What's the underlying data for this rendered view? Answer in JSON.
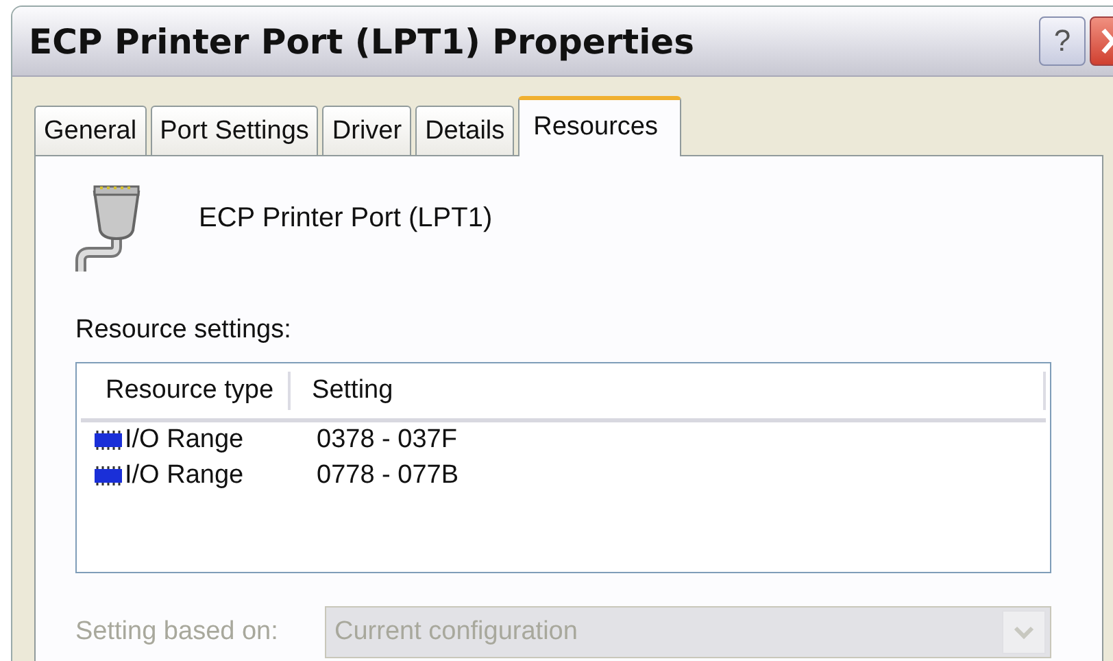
{
  "window": {
    "title": "ECP Printer Port (LPT1) Properties",
    "help": "?"
  },
  "tabs": [
    {
      "label": "General",
      "selected": false
    },
    {
      "label": "Port Settings",
      "selected": false
    },
    {
      "label": "Driver",
      "selected": false
    },
    {
      "label": "Details",
      "selected": false
    },
    {
      "label": "Resources",
      "selected": true
    }
  ],
  "device": {
    "name": "ECP Printer Port (LPT1)"
  },
  "resource_settings": {
    "label": "Resource settings:",
    "columns": [
      "Resource type",
      "Setting"
    ],
    "rows": [
      {
        "type": "I/O Range",
        "setting": "0378 - 037F"
      },
      {
        "type": "I/O Range",
        "setting": "0778 - 077B"
      }
    ]
  },
  "setting_based_on": {
    "label": "Setting based on:",
    "value": "Current configuration",
    "disabled": true
  }
}
